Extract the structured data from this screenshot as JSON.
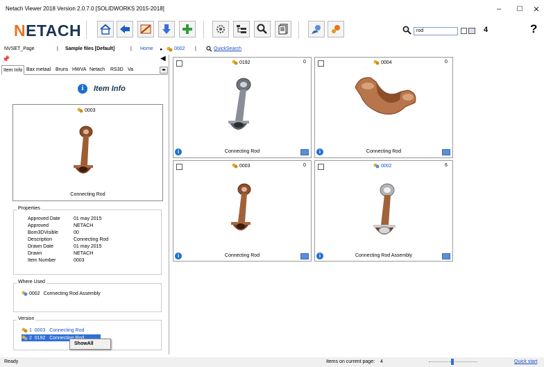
{
  "window": {
    "title": "Netach Viewer 2018   Version 2.0.7.0   [SOLIDWORKS 2015-2018]",
    "minimize": "–",
    "maximize": "☐",
    "close": "✕"
  },
  "toolbar": {
    "logo": "NETACH",
    "search_value": "rod",
    "count": "4",
    "help": "?"
  },
  "breadcrumb": {
    "page": "NVSET_Page",
    "sep1": "|",
    "files": "Sample files [Default]",
    "sep2": "|",
    "home": "Home",
    "arrow": "▸",
    "current": "0002",
    "sep3": "|",
    "quicksearch": "QuickSearch"
  },
  "left": {
    "tabs": [
      "Item Info",
      "Bax metaal",
      "Bruns",
      "HWVA",
      "Netach",
      "RS3D",
      "Va"
    ],
    "heading": "Item Info",
    "preview": {
      "number": "0003",
      "name": "Connecting Rod"
    },
    "properties_label": "Properties",
    "properties": [
      {
        "k": "Approved Date",
        "v": "01 may 2015"
      },
      {
        "k": "Approved",
        "v": "NETACH"
      },
      {
        "k": "Bom3DVisible",
        "v": "00"
      },
      {
        "k": "Description",
        "v": "Connecting Rod"
      },
      {
        "k": "Drawn Date",
        "v": "01 may 2015"
      },
      {
        "k": "Drawn",
        "v": "NETACH"
      },
      {
        "k": "Item Number",
        "v": "0003"
      }
    ],
    "where_used_label": "Where Used",
    "where_used": [
      {
        "number": "0002",
        "name": "Connecting Rod Assembly"
      }
    ],
    "version_label": "Version",
    "versions": [
      {
        "text": "1  0003   Connecting Rod"
      },
      {
        "text": "2  0192   Connecting Rod"
      }
    ],
    "context_menu": "ShowAll"
  },
  "cards": [
    {
      "number": "0192",
      "count": "0",
      "name": "Connecting Rod",
      "color": "#8a8f96",
      "type": "rod"
    },
    {
      "number": "0004",
      "count": "0",
      "name": "Connecting Rod",
      "color": "#b8744a",
      "type": "cap"
    },
    {
      "number": "0003",
      "count": "0",
      "name": "Connecting Rod",
      "color": "#a0623a",
      "type": "rod"
    },
    {
      "number": "0002",
      "count": "6",
      "name": "Connecting Rod Assembly",
      "color": "#a0623a",
      "type": "assembly"
    }
  ],
  "status": {
    "ready": "Ready",
    "items_label": "Items on current page:",
    "items_count": "4",
    "quickstart": "Quick start"
  }
}
